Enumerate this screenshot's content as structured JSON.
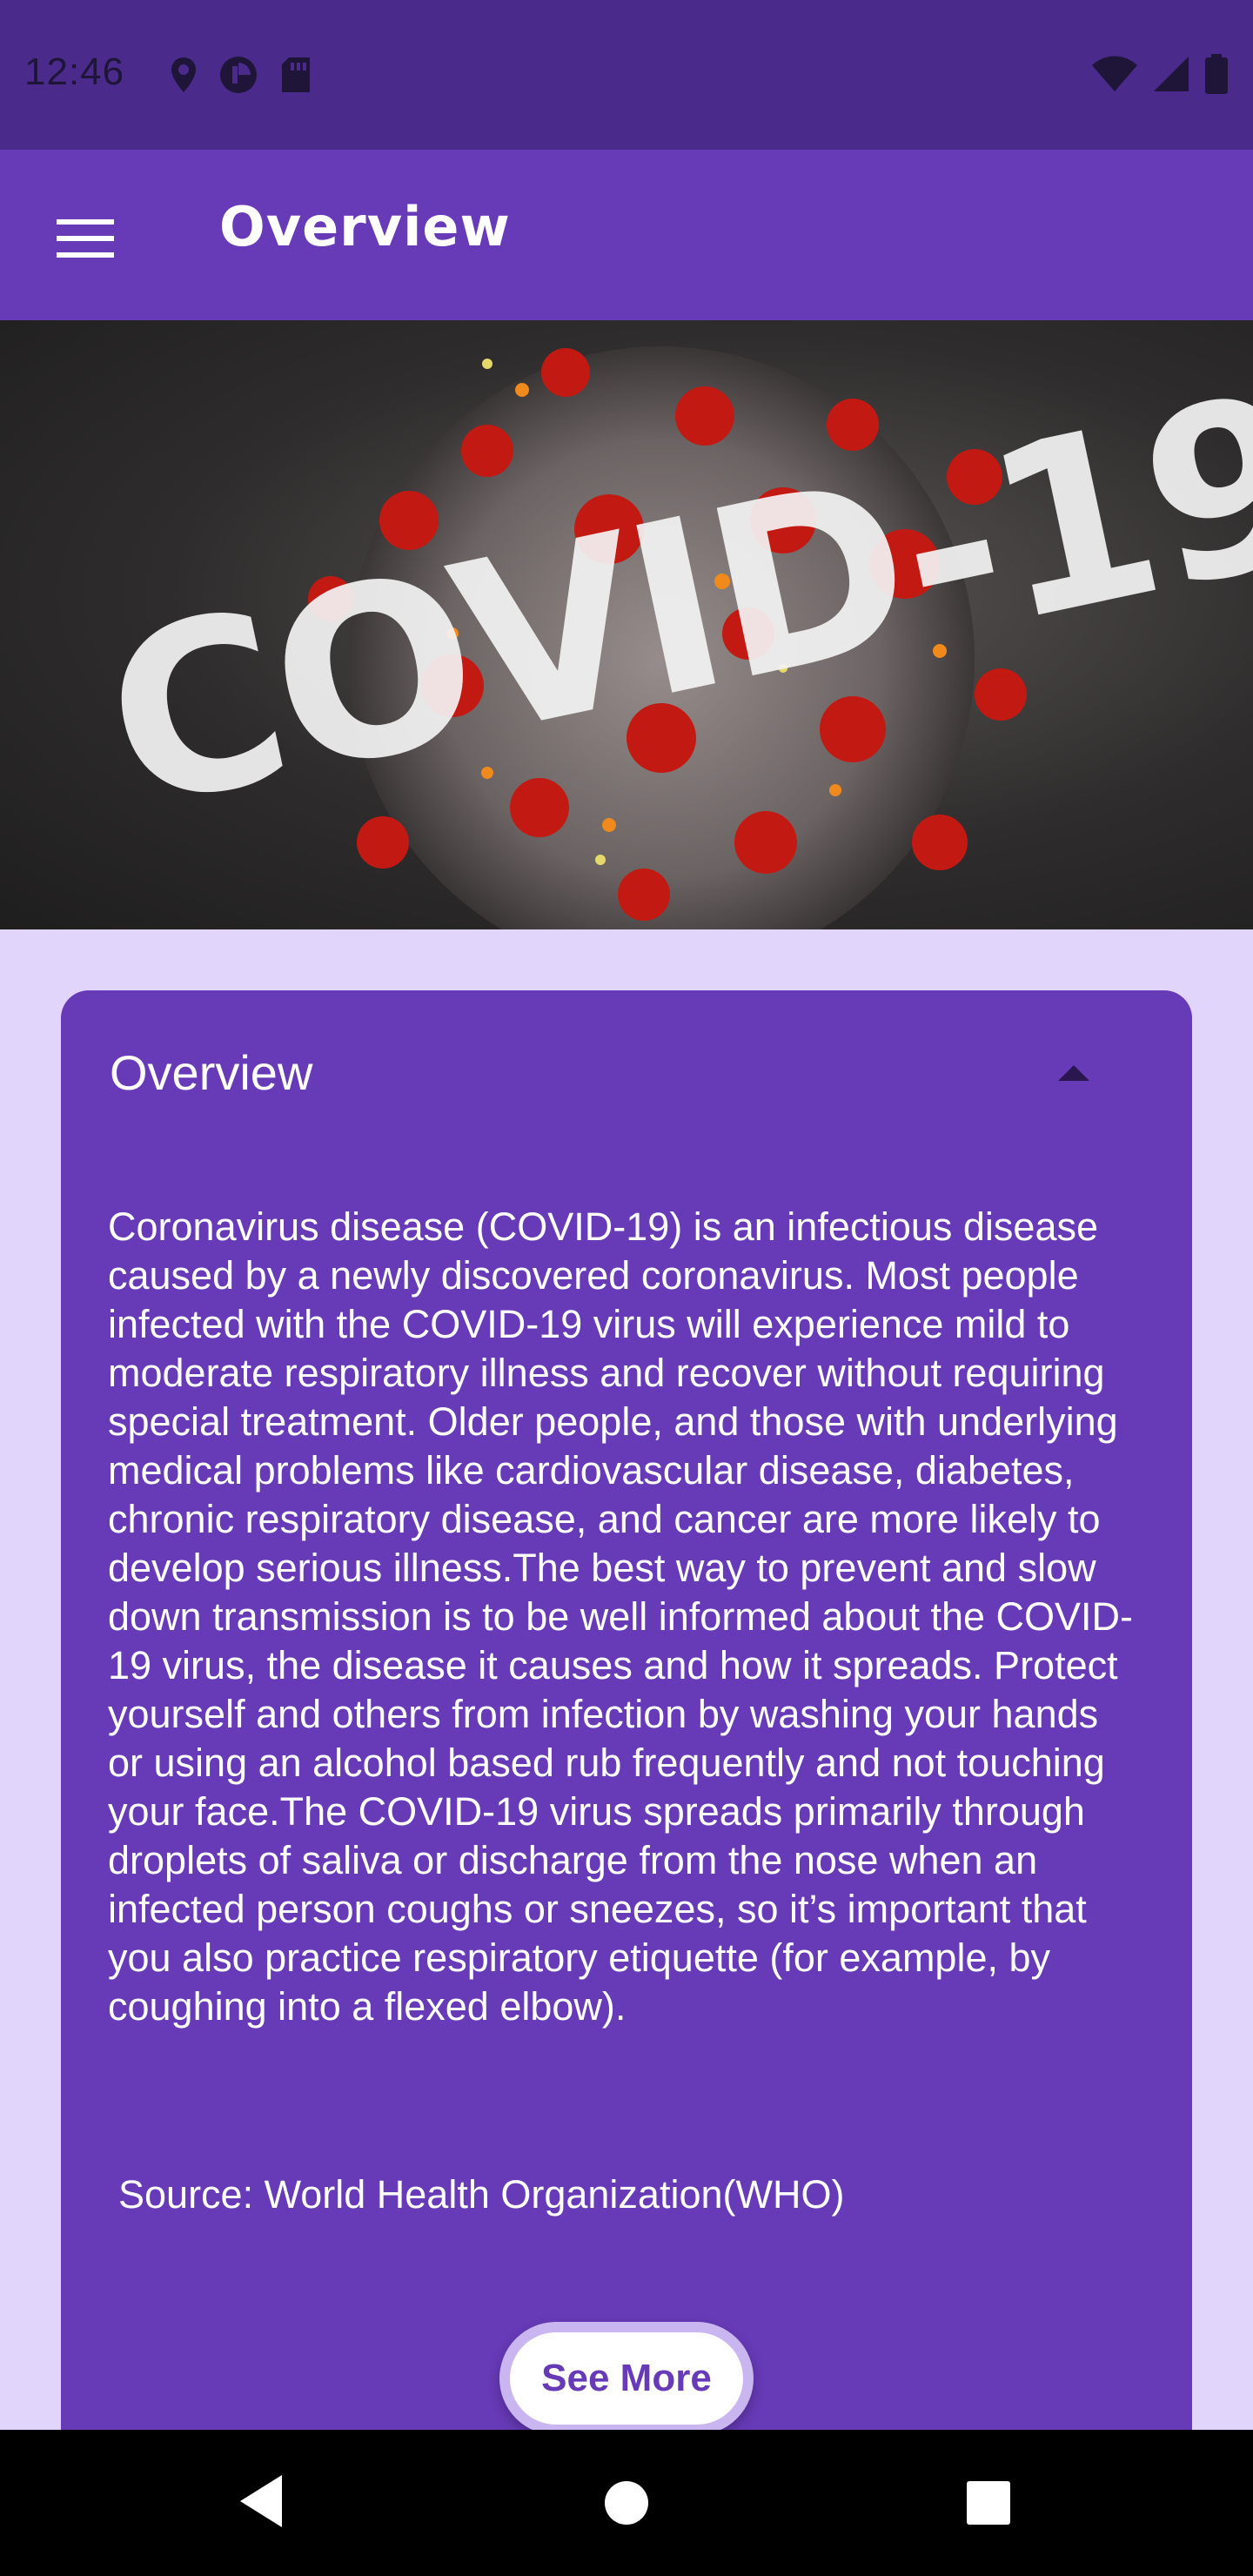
{
  "status_bar": {
    "time": "12:46",
    "left_icons": [
      "location-icon",
      "data-saver-icon",
      "sd-card-icon"
    ],
    "right_icons": [
      "wifi-icon",
      "cell-signal-icon",
      "battery-icon"
    ]
  },
  "app_bar": {
    "menu_icon": "hamburger-menu-icon",
    "title": "Overview"
  },
  "hero": {
    "text": "COVID-19"
  },
  "card": {
    "title": "Overview",
    "expanded": true,
    "body": "Coronavirus disease (COVID-19) is an infectious disease caused by a newly discovered coronavirus. Most people infected with the COVID-19 virus will experience mild to moderate respiratory illness and recover without requiring special treatment.  Older people, and those with underlying medical problems like cardiovascular disease, diabetes, chronic respiratory disease, and cancer are more likely to develop serious illness.The best way to prevent and slow down transmission is to be well informed about the COVID-19 virus, the disease it causes and how it spreads. Protect yourself and others from infection by washing your hands or using an alcohol based rub frequently and not touching your face.The COVID-19 virus spreads primarily through droplets of saliva or discharge from the nose when an infected person coughs or sneezes, so it’s important that you also practice respiratory etiquette (for example, by coughing into a flexed elbow).",
    "source": "Source: World Health Organization(WHO)",
    "see_more_label": "See More"
  },
  "nav_bar": {
    "back": "back-icon",
    "home": "home-icon",
    "recents": "recents-icon"
  },
  "colors": {
    "status_bar": "#4A2B8B",
    "primary": "#673AB7",
    "background": "#E1D5FB",
    "button_border": "#C9B6F0"
  }
}
